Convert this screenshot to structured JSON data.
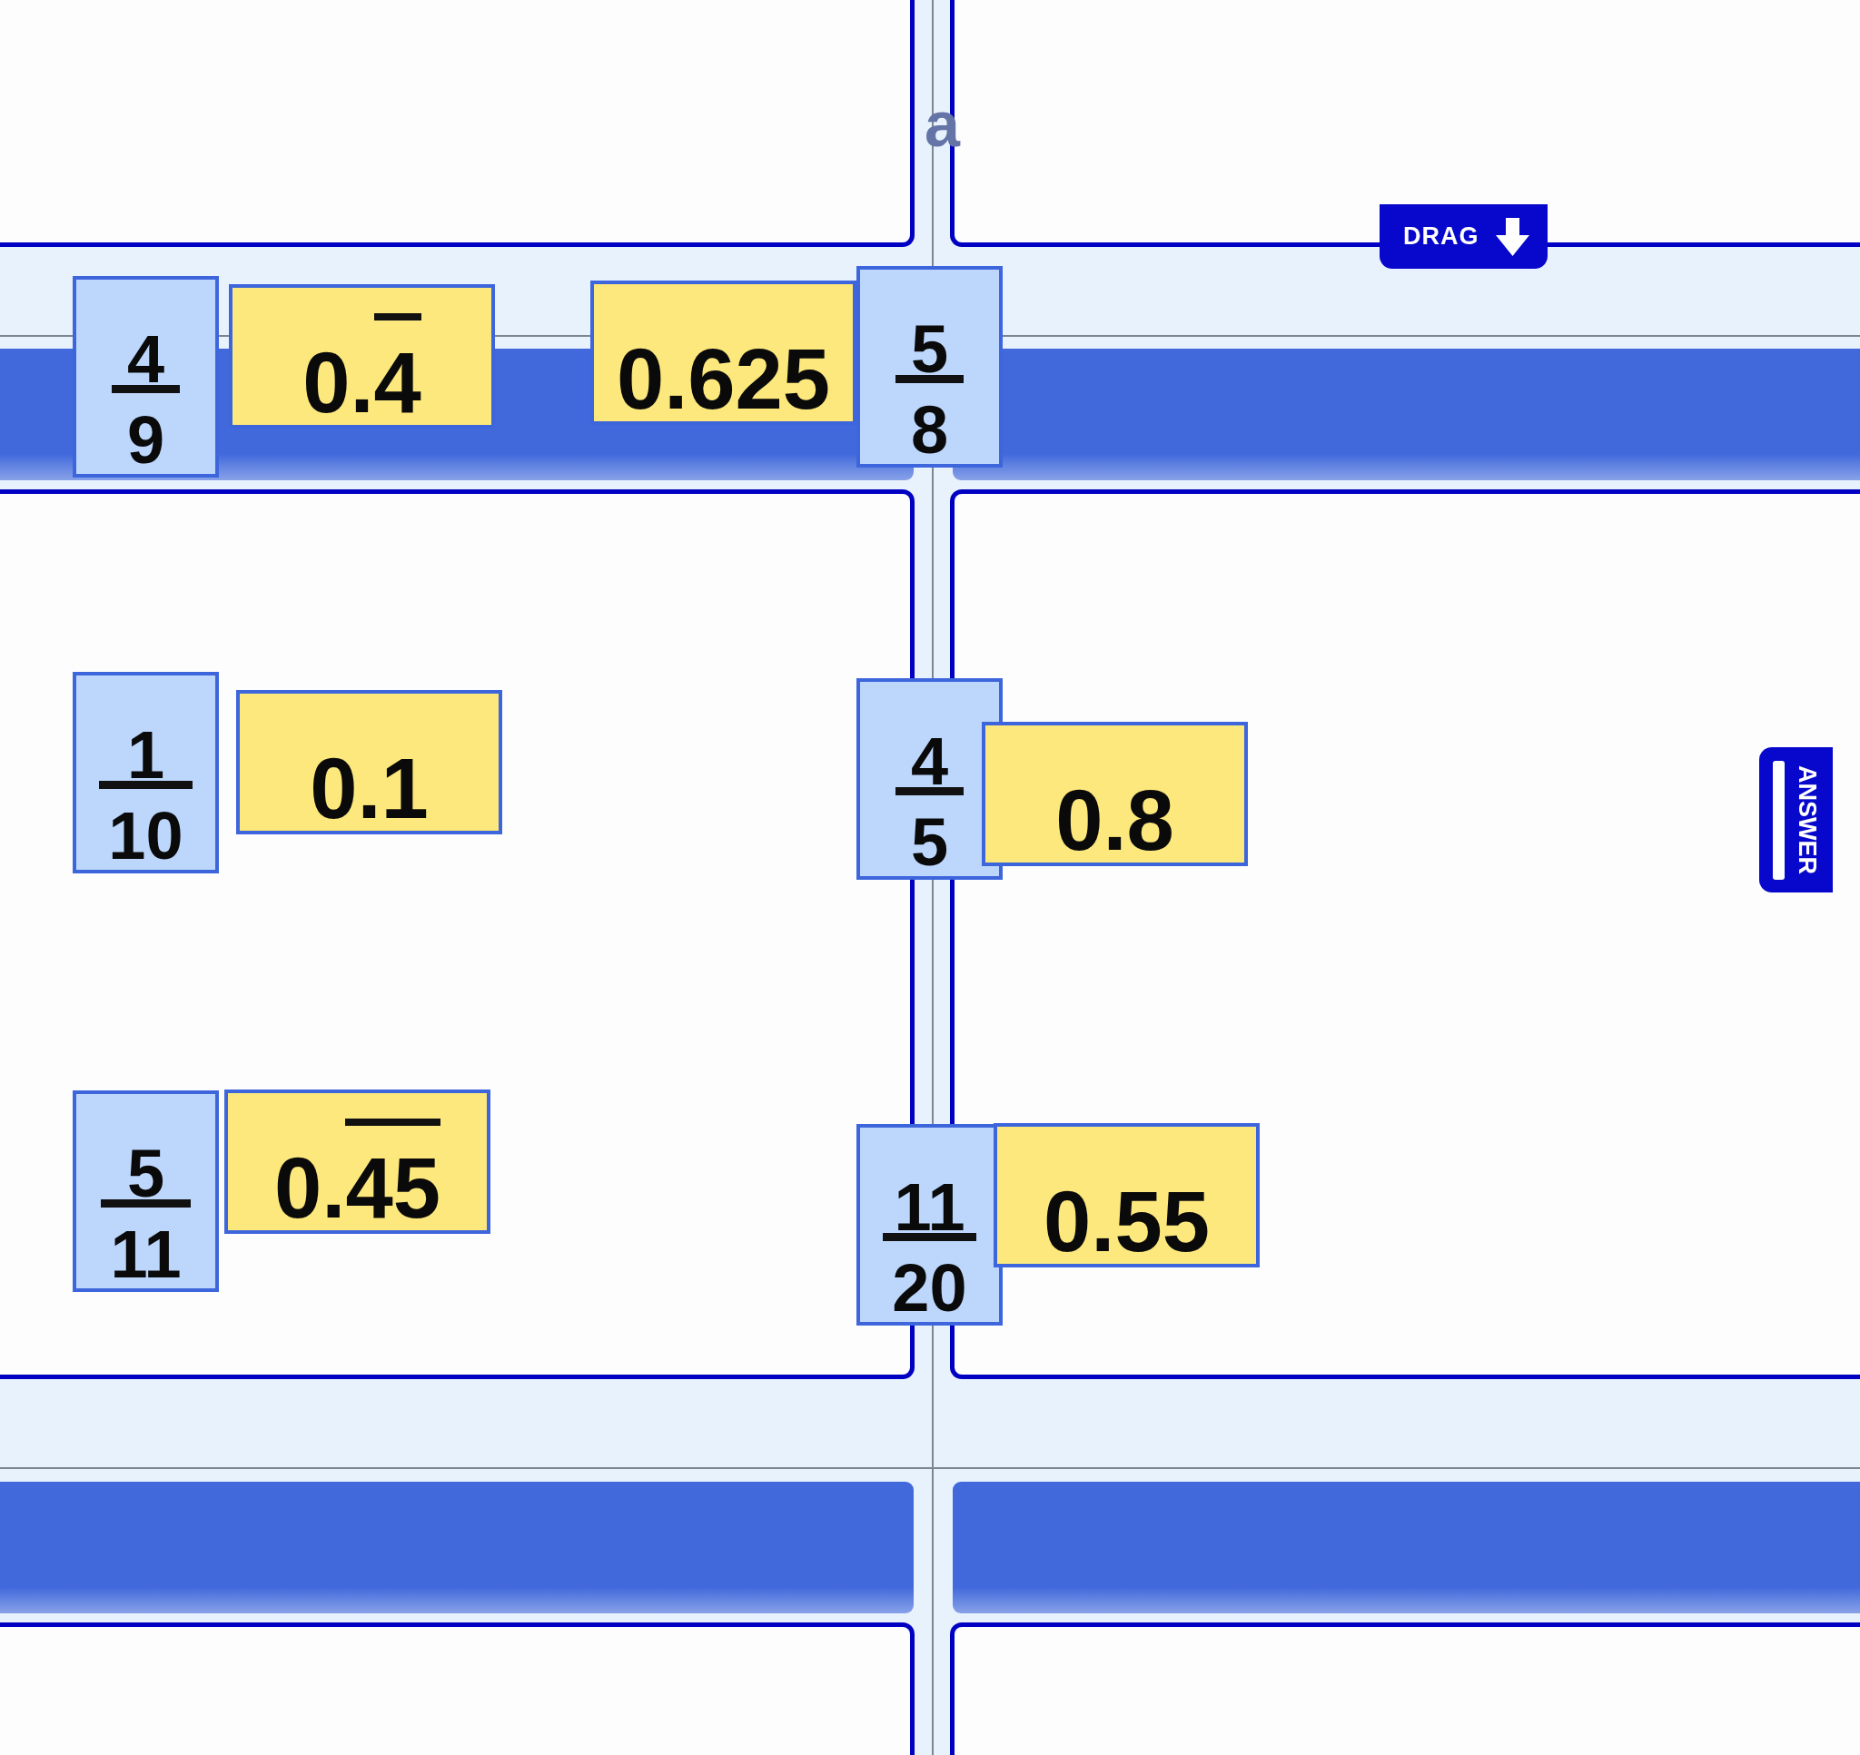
{
  "title": "a",
  "drag_tab": {
    "label": "DRAG"
  },
  "tiles": [
    {
      "kind": "fraction",
      "numerator": "4",
      "denominator": "9"
    },
    {
      "kind": "decimal",
      "fixed": "0.",
      "repeating": "4"
    },
    {
      "kind": "decimal",
      "fixed": "0.625"
    },
    {
      "kind": "fraction",
      "numerator": "5",
      "denominator": "8"
    },
    {
      "kind": "fraction",
      "numerator": "1",
      "denominator": "10"
    },
    {
      "kind": "decimal",
      "fixed": "0.1"
    },
    {
      "kind": "fraction",
      "numerator": "4",
      "denominator": "5"
    },
    {
      "kind": "decimal",
      "fixed": "0.8"
    },
    {
      "kind": "fraction",
      "numerator": "5",
      "denominator": "11"
    },
    {
      "kind": "decimal",
      "fixed": "0.",
      "repeating": "45"
    },
    {
      "kind": "fraction",
      "numerator": "11",
      "denominator": "20"
    },
    {
      "kind": "decimal",
      "fixed": "0.55"
    }
  ],
  "answer_tab": {
    "label": "ANSWER"
  }
}
